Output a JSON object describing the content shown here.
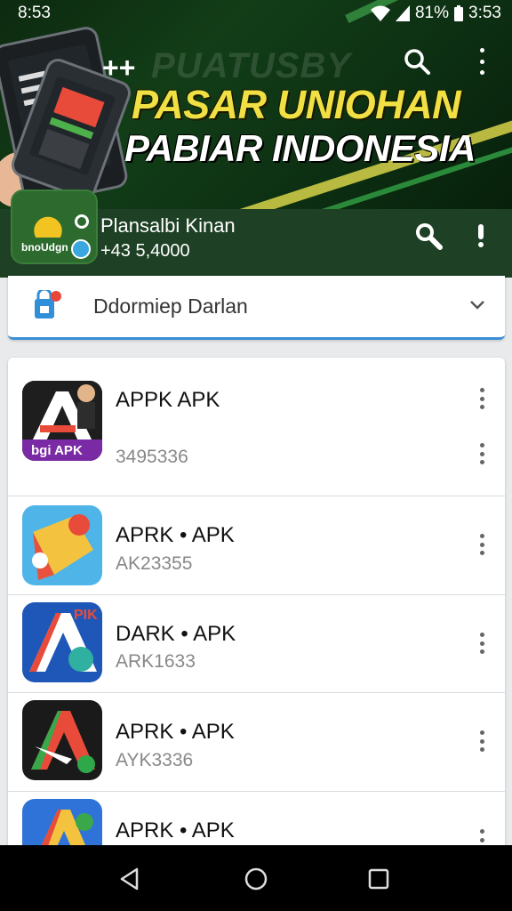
{
  "status_bar": {
    "time_left": "8:53",
    "battery": "81%",
    "time_right": "3:53"
  },
  "banner": {
    "bg_text": "PUATUSBY",
    "title_line_1": "PASAR UNIOHAN",
    "title_line_2": "PABIAR INDONESIA",
    "search_icon": "search-icon",
    "menu_icon": "more-vert-icon"
  },
  "profile": {
    "logo_text": "bnoUdgn",
    "name": "Plansalbi Kinan",
    "subtitle": "+43 5,4000"
  },
  "dropdown": {
    "label": "Ddormiep Darlan"
  },
  "apps": [
    {
      "name": "APPK APK",
      "sub": "3495336",
      "icon_label": "bgi APK"
    },
    {
      "name": "APRK • APK",
      "sub": "AK23355"
    },
    {
      "name": "DARK • APK",
      "sub": "ARK1633",
      "icon_label": "PIK"
    },
    {
      "name": "APRK • APK",
      "sub": "AYK3336"
    },
    {
      "name": "APRK • APK",
      "sub": ""
    }
  ],
  "colors": {
    "banner_bg": "#123d17",
    "title_yellow": "#f0e043",
    "profile_bar": "#1e4024",
    "accent_blue": "#3a8fd6"
  }
}
